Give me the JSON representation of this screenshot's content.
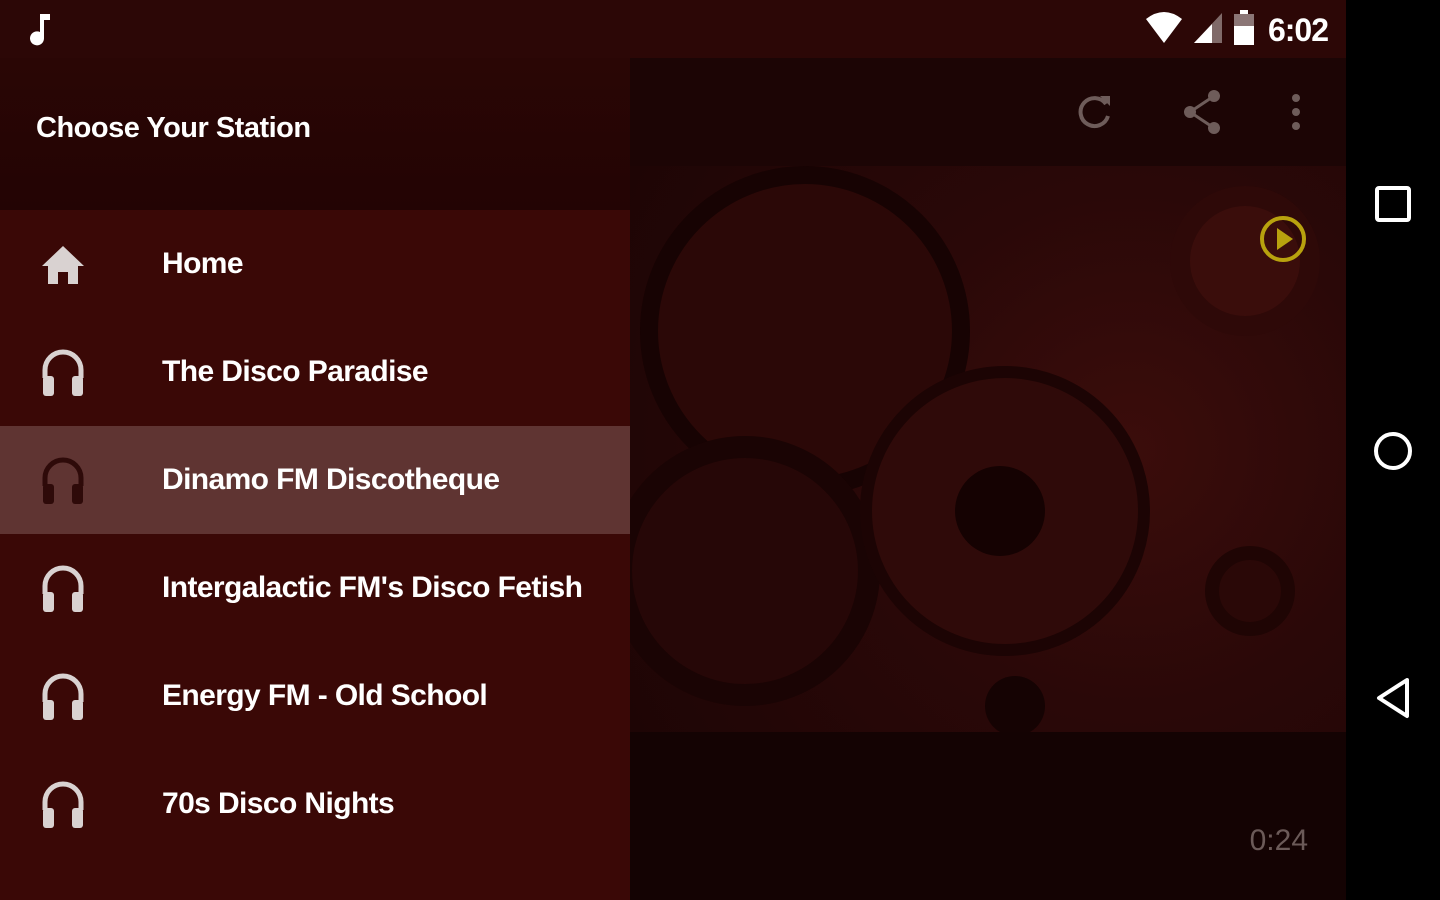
{
  "status_bar": {
    "time": "6:02",
    "icons": [
      "music-note-icon",
      "wifi-icon",
      "signal-icon",
      "battery-icon"
    ]
  },
  "drawer": {
    "title": "Choose Your Station",
    "items": [
      {
        "label": "Home",
        "icon": "home-icon",
        "selected": false
      },
      {
        "label": "The Disco Paradise",
        "icon": "headphones-icon",
        "selected": false
      },
      {
        "label": "Dinamo FM Discotheque",
        "icon": "headphones-icon",
        "selected": true
      },
      {
        "label": "Intergalactic FM's Disco Fetish",
        "icon": "headphones-icon",
        "selected": false
      },
      {
        "label": "Energy FM - Old School",
        "icon": "headphones-icon",
        "selected": false
      },
      {
        "label": "70s Disco Nights",
        "icon": "headphones-icon",
        "selected": false
      }
    ]
  },
  "toolbar": {
    "actions": [
      "refresh-icon",
      "share-icon",
      "more-vert-icon"
    ]
  },
  "player": {
    "elapsed": "0:24",
    "play_icon": "play-circle-icon"
  },
  "nav_bar": {
    "buttons": [
      "recents-button",
      "home-button",
      "back-button"
    ]
  },
  "colors": {
    "status_bar": "#2c0706",
    "drawer_bg": "#3a0806",
    "drawer_header": "#260505",
    "selected_row": "#5f3432",
    "accent_play": "#b8a20e"
  }
}
